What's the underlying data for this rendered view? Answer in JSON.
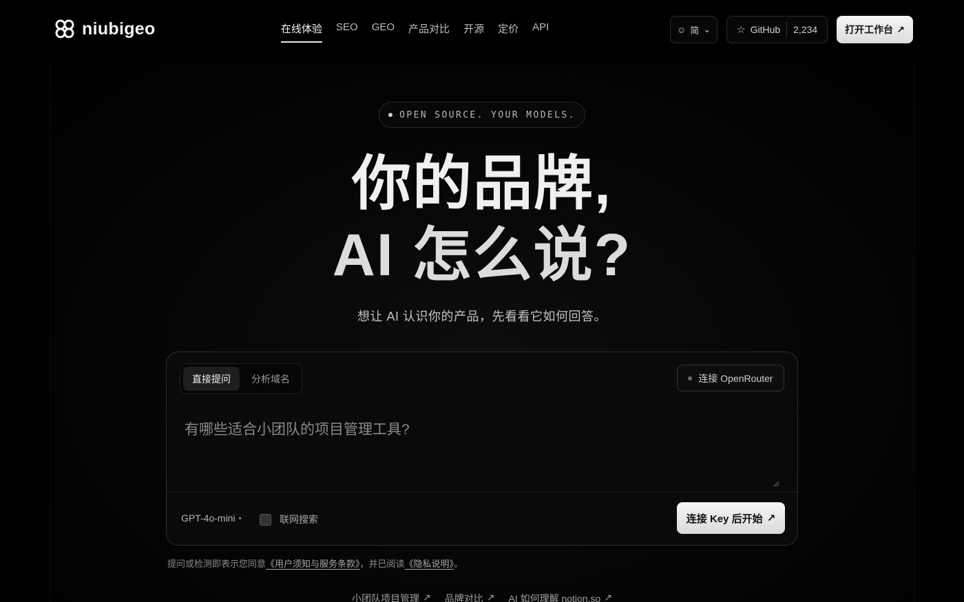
{
  "brand": {
    "name": "niubigeo"
  },
  "nav": {
    "links": [
      {
        "label": "在线体验"
      },
      {
        "label": "SEO"
      },
      {
        "label": "GEO"
      },
      {
        "label": "产品对比"
      },
      {
        "label": "开源"
      },
      {
        "label": "定价"
      },
      {
        "label": "API"
      }
    ],
    "lang": {
      "icon": "☺",
      "label": "简",
      "caret": "⌄"
    },
    "github": {
      "icon": "☆",
      "label": "GitHub",
      "stars": "2,234"
    },
    "workspace": {
      "label": "打开工作台",
      "arrow": "↗"
    }
  },
  "hero": {
    "pill": "OPEN SOURCE. YOUR MODELS.",
    "headline_line1": "你的品牌,",
    "headline_line2": "AI 怎么说?",
    "subtitle": "想让 AI 认识你的产品，先看看它如何回答。"
  },
  "card": {
    "tabs": [
      {
        "label": "直接提问"
      },
      {
        "label": "分析域名"
      }
    ],
    "openrouter": "连接 OpenRouter",
    "prompt_placeholder": "有哪些适合小团队的项目管理工具?",
    "model": "GPT-4o-mini",
    "model_caret": "▾",
    "web_search": "联网搜索",
    "start": {
      "label": "连接 Key 后开始",
      "arrow": "↗"
    }
  },
  "terms": {
    "prefix": "提问或检测即表示您同意",
    "tos": "《用户须知与服务条款》",
    "middle": "，并已阅读",
    "privacy": "《隐私说明》",
    "suffix": "。"
  },
  "examples": [
    {
      "label": "小团队项目管理",
      "arrow": "↗"
    },
    {
      "label": "品牌对比",
      "arrow": "↗"
    },
    {
      "label": "AI 如何理解 notion.so",
      "arrow": "↗"
    }
  ],
  "colors": {
    "background": "#000000",
    "accent": "#f0f0f0",
    "primary_button": "#e8e8e8"
  }
}
